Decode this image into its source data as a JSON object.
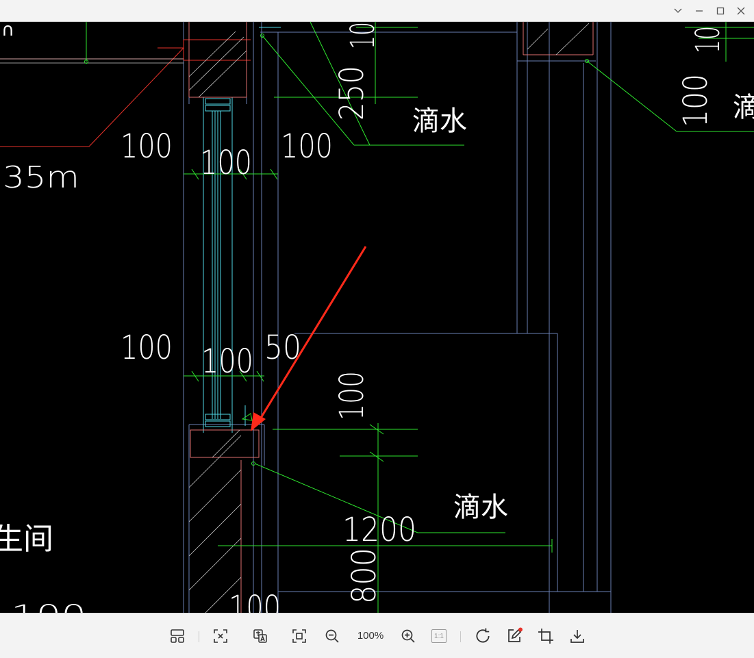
{
  "window": {
    "controls": {
      "collapse": "chevron-down-icon",
      "minimize": "minimize-icon",
      "maximize": "maximize-icon",
      "close": "close-icon"
    }
  },
  "drawing": {
    "dims": {
      "d100_a": "100",
      "d100_b": "100",
      "d100_c": "100",
      "d250": "250",
      "d35m": "35m",
      "d100_d": "100",
      "d100_e": "100",
      "d50": "50",
      "d100_f": "100",
      "d1200": "1200",
      "d800": "800",
      "d100_g": "100",
      "d100_h": "100",
      "d100_i": "100",
      "d10_top": "10"
    },
    "labels": {
      "drip_top": "滴水",
      "drip_bottom": "滴水",
      "drip_right_partial": "滴",
      "room_partial": "生间",
      "corner_partial": "∩"
    },
    "colors": {
      "red": "#e8322a",
      "green": "#2ee62e",
      "cyan": "#4fd7e6",
      "blue": "#6a7fb5",
      "white": "#ffffff",
      "pink": "#e07070"
    }
  },
  "toolbar": {
    "zoom_level": "100%",
    "actual_size_label": "1:1",
    "buttons": [
      "layout-icon",
      "fit-icon",
      "translate-icon",
      "frame-icon",
      "zoom-out-icon",
      "zoom-in-icon",
      "actual-size-icon",
      "rotate-icon",
      "edit-icon",
      "crop-icon",
      "download-icon"
    ]
  }
}
